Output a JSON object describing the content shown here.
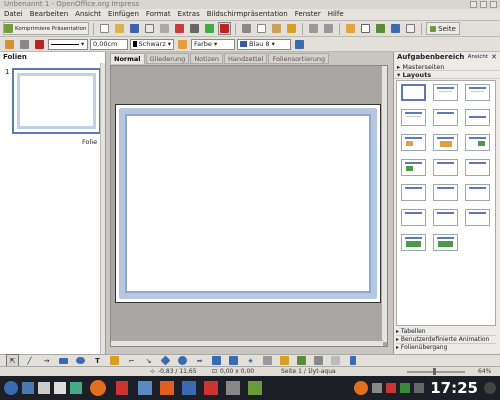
{
  "window": {
    "title": "Unbenannt 1 - OpenOffice.org Impress"
  },
  "menu": [
    "Datei",
    "Bearbeiten",
    "Ansicht",
    "Einfügen",
    "Format",
    "Extras",
    "Bildschirmpräsentation",
    "Fenster",
    "Hilfe"
  ],
  "toolbar": {
    "compress_label": "Komprimiere Präsentation",
    "slide_label": "Seite",
    "line_width": "0,00cm",
    "line_color": "Schwarz",
    "area_mode": "Farbe",
    "area_color": "Blau 8"
  },
  "slides_panel": {
    "title": "Folien",
    "slide_number": "1",
    "slide_label": "Folie 1"
  },
  "view_tabs": [
    "Normal",
    "Gliederung",
    "Notizen",
    "Handzettel",
    "Foliensortierung"
  ],
  "tasks": {
    "title": "Aufgabenbereich",
    "view_label": "Ansicht",
    "sections_top": [
      "Masterseiten",
      "Layouts"
    ],
    "sections_bottom": [
      "Tabellen",
      "Benutzerdefinierte Animation",
      "Folienübergang"
    ]
  },
  "status": {
    "position": "-0,83 / 11,65",
    "size": "0,00 x 0,00",
    "slide": "Seite 1 / 1",
    "master": "lyt-aqua",
    "zoom": "64%"
  },
  "taskbar": {
    "clock": "17:25"
  },
  "colors": {
    "frame_blue": "#8fa8cf",
    "highlight": "#5d7ab6"
  }
}
